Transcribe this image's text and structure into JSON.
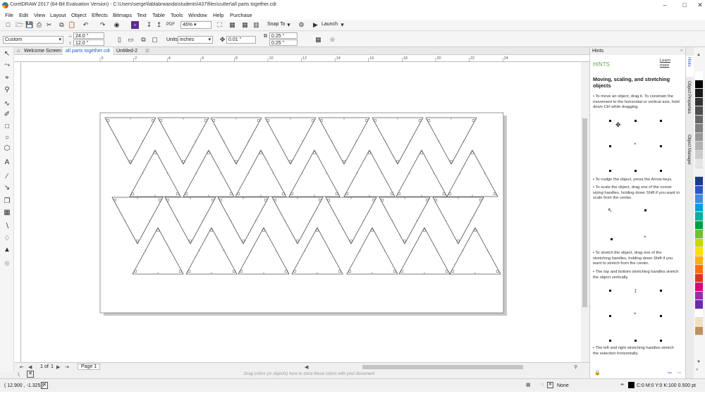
{
  "window": {
    "title": "CorelDRAW 2017 (64-Bit Evaluation Version) - C:\\Users\\serge\\fablabrwanda\\students\\437\\files\\cutter\\all parts together.cdr"
  },
  "menu": [
    "File",
    "Edit",
    "View",
    "Layout",
    "Object",
    "Effects",
    "Bitmaps",
    "Text",
    "Table",
    "Tools",
    "Window",
    "Help",
    "Purchase"
  ],
  "toolbar": {
    "zoom": "46%",
    "snap_to": "Snap To",
    "launch": "Launch"
  },
  "propertybar": {
    "page_size": "Custom",
    "width": "24.0 \"",
    "height": "12.0 \"",
    "units_label": "Units:",
    "units_value": "inches",
    "nudge": "0.01 \"",
    "dup_x": "0.25 \"",
    "dup_y": "0.25 \""
  },
  "tabs": [
    "Welcome Screen",
    "all parts together.cdr",
    "Untitled-2"
  ],
  "ruler": {
    "ticks": [
      "0",
      "2",
      "4",
      "6",
      "8",
      "10",
      "12",
      "14",
      "16",
      "18",
      "20",
      "22",
      "24"
    ]
  },
  "page_nav": {
    "current": "1",
    "of_label": "of",
    "total": "1",
    "page_tab": "Page 1"
  },
  "palette_hint": "Drag colors (or objects) here to store these colors with your document",
  "hints": {
    "panel_title": "Hints",
    "header": "HINTS",
    "learn_more": "Learn more",
    "title": "Moving, scaling, and stretching objects",
    "p1": "• To move an object, drag it. To constrain the movement to the horizontal or vertical axis, hold down Ctrl while dragging.",
    "p2": "• To nudge the object, press the Arrow keys.",
    "p3": "• To scale the object, drag one of the corner sizing handles, holding down Shift if you want to scale from the center.",
    "p4": "• To stretch the object, drag one of the stretching handles, holding down Shift if you want to stretch from the center.",
    "p5": "• The top and bottom stretching handles stretch the object vertically.",
    "p6": "• The left and right stretching handles stretch the selection horizontally."
  },
  "docker_tabs": [
    "Hints",
    "Object Properties",
    "Object Manager"
  ],
  "status": {
    "coords": "( 12.900 , -1.325 )",
    "fill": "None",
    "outline": "C:0 M:0 Y:0 K:100  0.500 pt"
  },
  "colors": {
    "accent": "#2060c0",
    "hint_header": "#6aa84f",
    "swatches": [
      "#ffffff",
      "#000000",
      "#1a1a1a",
      "#333333",
      "#4d4d4d",
      "#666666",
      "#808080",
      "#999999",
      "#b3b3b3",
      "#cccccc",
      "#e6e6e6",
      "#f2f2f2",
      "#1a3a8a",
      "#2b57c7",
      "#3d8ee0",
      "#00a0e0",
      "#00b0a0",
      "#00a040",
      "#70c030",
      "#c8d800",
      "#ffe000",
      "#ffb000",
      "#ff7000",
      "#e83020",
      "#e0007a",
      "#9c2ab0",
      "#6a2ab0",
      "#ffffff",
      "#f0e0c0",
      "#c09060"
    ]
  }
}
